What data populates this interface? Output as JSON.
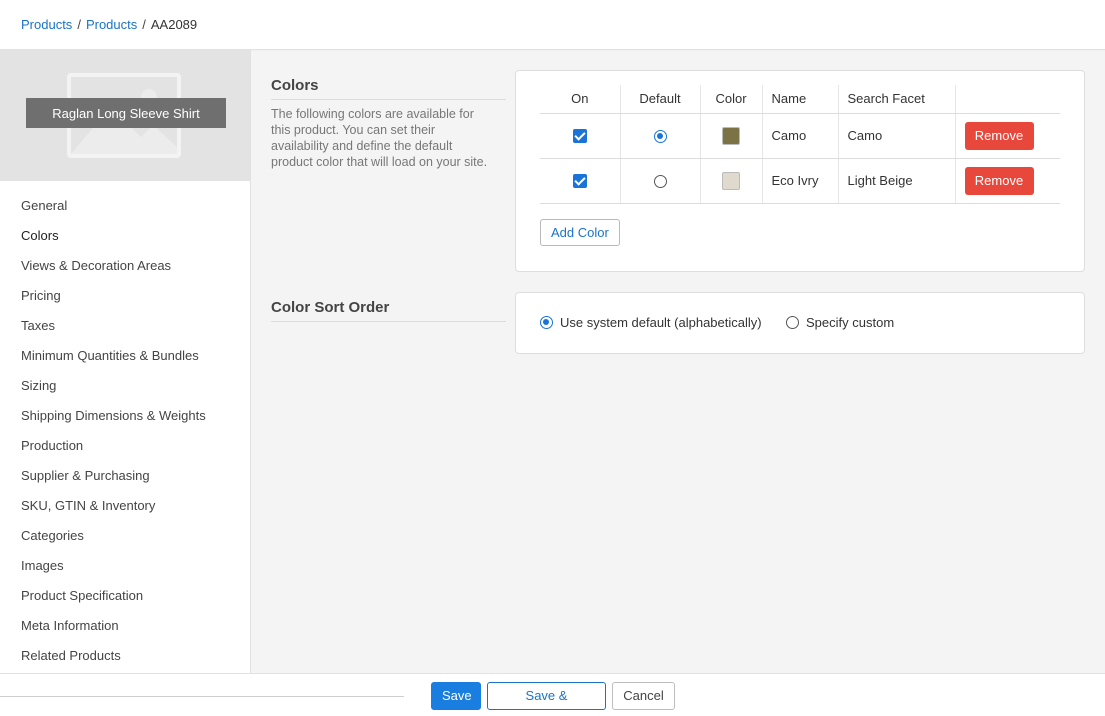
{
  "breadcrumb": {
    "items": [
      "Products",
      "Products",
      "AA2089"
    ],
    "separator": "/"
  },
  "sidebar": {
    "product_name": "Raglan Long Sleeve Shirt",
    "thumbnail_icon": "image-placeholder-icon",
    "nav": [
      {
        "label": "General",
        "active": false
      },
      {
        "label": "Colors",
        "active": true
      },
      {
        "label": "Views & Decoration Areas",
        "active": false
      },
      {
        "label": "Pricing",
        "active": false
      },
      {
        "label": "Taxes",
        "active": false
      },
      {
        "label": "Minimum Quantities & Bundles",
        "active": false
      },
      {
        "label": "Sizing",
        "active": false
      },
      {
        "label": "Shipping Dimensions & Weights",
        "active": false
      },
      {
        "label": "Production",
        "active": false
      },
      {
        "label": "Supplier & Purchasing",
        "active": false
      },
      {
        "label": "SKU, GTIN & Inventory",
        "active": false
      },
      {
        "label": "Categories",
        "active": false
      },
      {
        "label": "Images",
        "active": false
      },
      {
        "label": "Product Specification",
        "active": false
      },
      {
        "label": "Meta Information",
        "active": false
      },
      {
        "label": "Related Products",
        "active": false
      }
    ]
  },
  "colors_section": {
    "title": "Colors",
    "description": "The following colors are available for this product. You can set their availability and define the default product color that will load on your site.",
    "columns": [
      "On",
      "Default",
      "Color",
      "Name",
      "Search Facet",
      ""
    ],
    "rows": [
      {
        "on": true,
        "default": true,
        "swatch": "#7b7345",
        "name": "Camo",
        "search_facet": "Camo",
        "action": "Remove"
      },
      {
        "on": true,
        "default": false,
        "swatch": "#e0d9cd",
        "name": "Eco Ivry",
        "search_facet": "Light Beige",
        "action": "Remove"
      }
    ],
    "add_button": "Add Color"
  },
  "sort_section": {
    "title": "Color Sort Order",
    "options": [
      {
        "label": "Use system default (alphabetically)",
        "selected": true
      },
      {
        "label": "Specify custom",
        "selected": false
      }
    ]
  },
  "footer": {
    "save": "Save",
    "save_continue": "Save & Continue",
    "cancel": "Cancel"
  },
  "colors": {
    "accent": "#1a73d9",
    "danger": "#e8483b",
    "link": "#1a73c9"
  }
}
